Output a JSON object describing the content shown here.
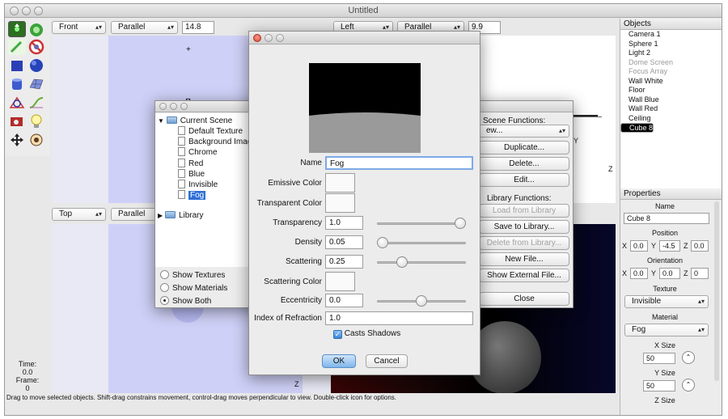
{
  "window": {
    "title": "Untitled"
  },
  "top_left_view": {
    "view": "Front",
    "projection": "Parallel",
    "scale": "14.8"
  },
  "top_right_view": {
    "view": "Left",
    "projection": "Parallel",
    "scale": "9.9"
  },
  "bottom_left_view": {
    "view": "Top",
    "projection": "Parallel"
  },
  "objects_panel": {
    "header": "Objects",
    "items": [
      {
        "label": "Camera 1",
        "state": "normal"
      },
      {
        "label": "Sphere 1",
        "state": "normal"
      },
      {
        "label": "Light 2",
        "state": "normal"
      },
      {
        "label": "Dome Screen",
        "state": "disabled"
      },
      {
        "label": "Focus Array",
        "state": "disabled"
      },
      {
        "label": "Wall White",
        "state": "normal"
      },
      {
        "label": "Floor",
        "state": "normal"
      },
      {
        "label": "Wall Blue",
        "state": "normal"
      },
      {
        "label": "Wall Red",
        "state": "normal"
      },
      {
        "label": "Ceiling",
        "state": "normal"
      },
      {
        "label": "Cube 8",
        "state": "selected"
      }
    ]
  },
  "properties_panel": {
    "header": "Properties",
    "name_label": "Name",
    "name_value": "Cube 8",
    "position_label": "Position",
    "position": {
      "x": "0.0",
      "y": "-4.5",
      "z": "0.0"
    },
    "orientation_label": "Orientation",
    "orientation": {
      "x": "0.0",
      "y": "0.0",
      "z": "0"
    },
    "texture_label": "Texture",
    "texture_value": "Invisible",
    "material_label": "Material",
    "material_value": "Fog",
    "xsize_label": "X Size",
    "xsize_value": "50",
    "ysize_label": "Y Size",
    "ysize_value": "50",
    "zsize_label": "Z Size"
  },
  "time_readout": {
    "time_label": "Time:",
    "time_value": "0.0",
    "frame_label": "Frame:",
    "frame_value": "0"
  },
  "status_bar": "Drag to move selected objects. Shift-drag constrains movement, control-drag moves perpendicular to view. Double-click icon for options.",
  "scene_window": {
    "tree": {
      "root": "Current Scene",
      "children": [
        "Default Texture",
        "Background Image",
        "Chrome",
        "Red",
        "Blue",
        "Invisible",
        "Fog"
      ],
      "selected": "Fog",
      "library": "Library"
    },
    "options": [
      {
        "label": "Show Textures",
        "checked": false
      },
      {
        "label": "Show Materials",
        "checked": false
      },
      {
        "label": "Show Both",
        "checked": true
      }
    ],
    "scene_functions_title": "Scene Functions:",
    "new_select": "ew...",
    "duplicate": "Duplicate...",
    "delete": "Delete...",
    "edit": "Edit...",
    "library_functions_title": "Library Functions:",
    "load_from_library": "Load from Library",
    "save_to_library": "Save to Library...",
    "delete_from_library": "Delete from Library...",
    "new_file": "New File...",
    "show_external_file": "Show External File...",
    "close": "Close"
  },
  "material_dialog": {
    "name_label": "Name",
    "name_value": "Fog",
    "emissive_color_label": "Emissive Color",
    "transparent_color_label": "Transparent Color",
    "transparency_label": "Transparency",
    "transparency_value": "1.0",
    "transparency_slider": 1.0,
    "density_label": "Density",
    "density_value": "0.05",
    "density_slider": 0.0,
    "scattering_label": "Scattering",
    "scattering_value": "0.25",
    "scattering_slider": 0.25,
    "scattering_color_label": "Scattering Color",
    "eccentricity_label": "Eccentricity",
    "eccentricity_value": "0.0",
    "eccentricity_slider": 0.5,
    "ior_label": "Index of Refraction",
    "ior_value": "1.0",
    "casts_shadows_label": "Casts Shadows",
    "casts_shadows": true,
    "ok": "OK",
    "cancel": "Cancel"
  },
  "colors": {
    "viewport_bg": "#cfd0f7",
    "selection": "#2f6fd6"
  }
}
